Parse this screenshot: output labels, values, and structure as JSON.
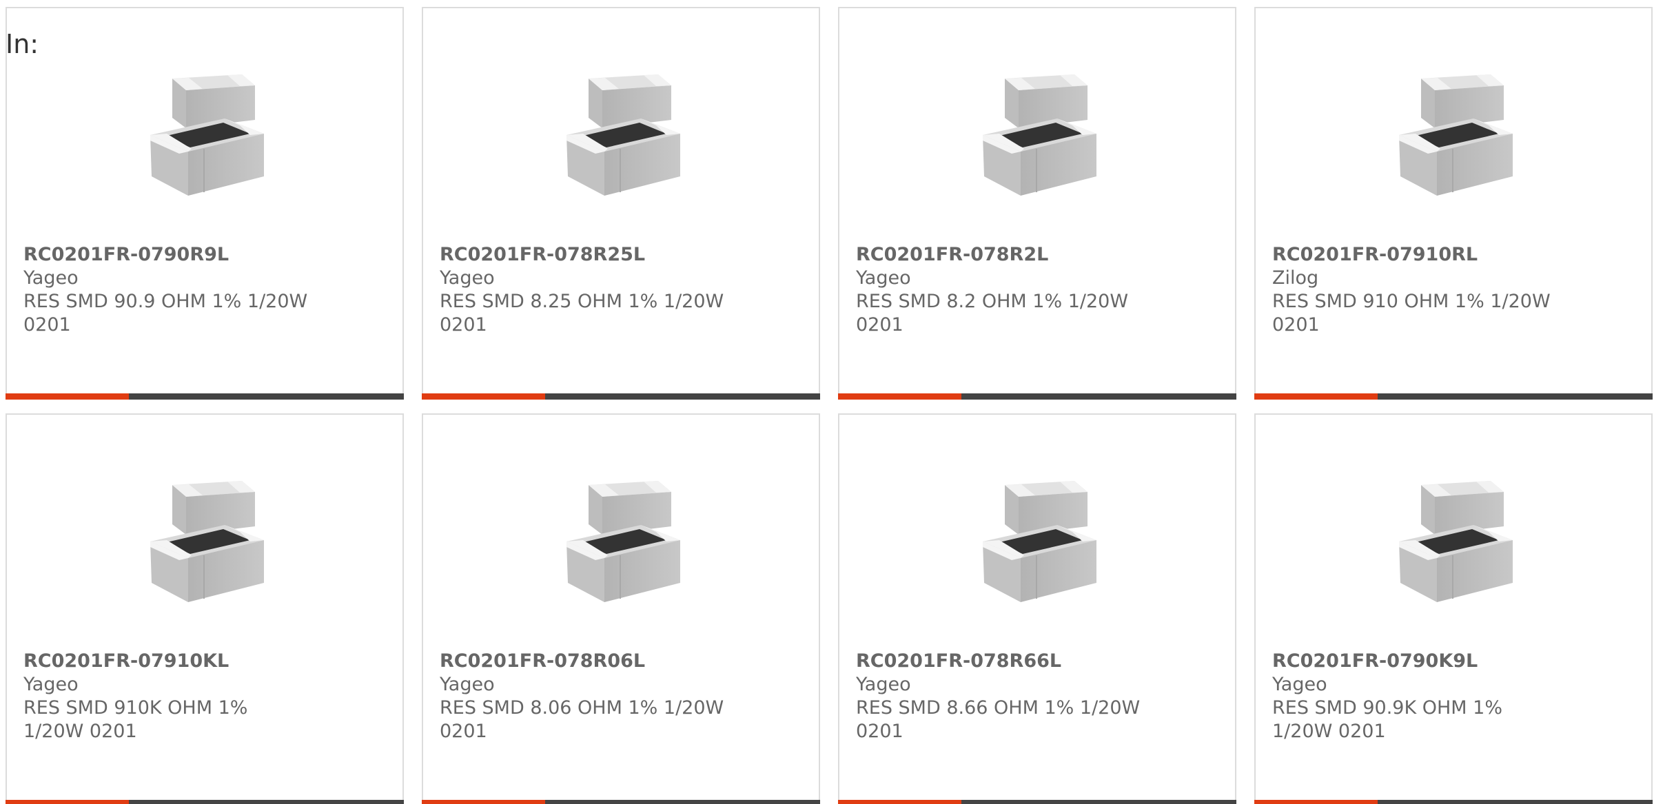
{
  "header": {
    "label": "In:"
  },
  "colors": {
    "accent": "#e03c12",
    "track": "#444444",
    "text": "#666666",
    "border": "#dcdcdc"
  },
  "products": [
    {
      "part_number": "RC0201FR-0790R9L",
      "manufacturer": "Yageo",
      "description": "RES SMD 90.9 OHM 1% 1/20W 0201",
      "image_icon": "smd-resistor-icon",
      "progress": 0.31
    },
    {
      "part_number": "RC0201FR-078R25L",
      "manufacturer": "Yageo",
      "description": "RES SMD 8.25 OHM 1% 1/20W 0201",
      "image_icon": "smd-resistor-icon",
      "progress": 0.31
    },
    {
      "part_number": "RC0201FR-078R2L",
      "manufacturer": "Yageo",
      "description": "RES SMD 8.2 OHM 1% 1/20W 0201",
      "image_icon": "smd-resistor-icon",
      "progress": 0.31
    },
    {
      "part_number": "RC0201FR-07910RL",
      "manufacturer": "Zilog",
      "description": "RES SMD 910 OHM 1% 1/20W 0201",
      "image_icon": "smd-resistor-icon",
      "progress": 0.31
    },
    {
      "part_number": "RC0201FR-07910KL",
      "manufacturer": "Yageo",
      "description": "RES SMD 910K OHM 1% 1/20W 0201",
      "image_icon": "smd-resistor-icon",
      "progress": 0.31
    },
    {
      "part_number": "RC0201FR-078R06L",
      "manufacturer": "Yageo",
      "description": "RES SMD 8.06 OHM 1% 1/20W 0201",
      "image_icon": "smd-resistor-icon",
      "progress": 0.31
    },
    {
      "part_number": "RC0201FR-078R66L",
      "manufacturer": "Yageo",
      "description": "RES SMD 8.66 OHM 1% 1/20W 0201",
      "image_icon": "smd-resistor-icon",
      "progress": 0.31
    },
    {
      "part_number": "RC0201FR-0790K9L",
      "manufacturer": "Yageo",
      "description": "RES SMD 90.9K OHM 1% 1/20W 0201",
      "image_icon": "smd-resistor-icon",
      "progress": 0.31
    }
  ]
}
